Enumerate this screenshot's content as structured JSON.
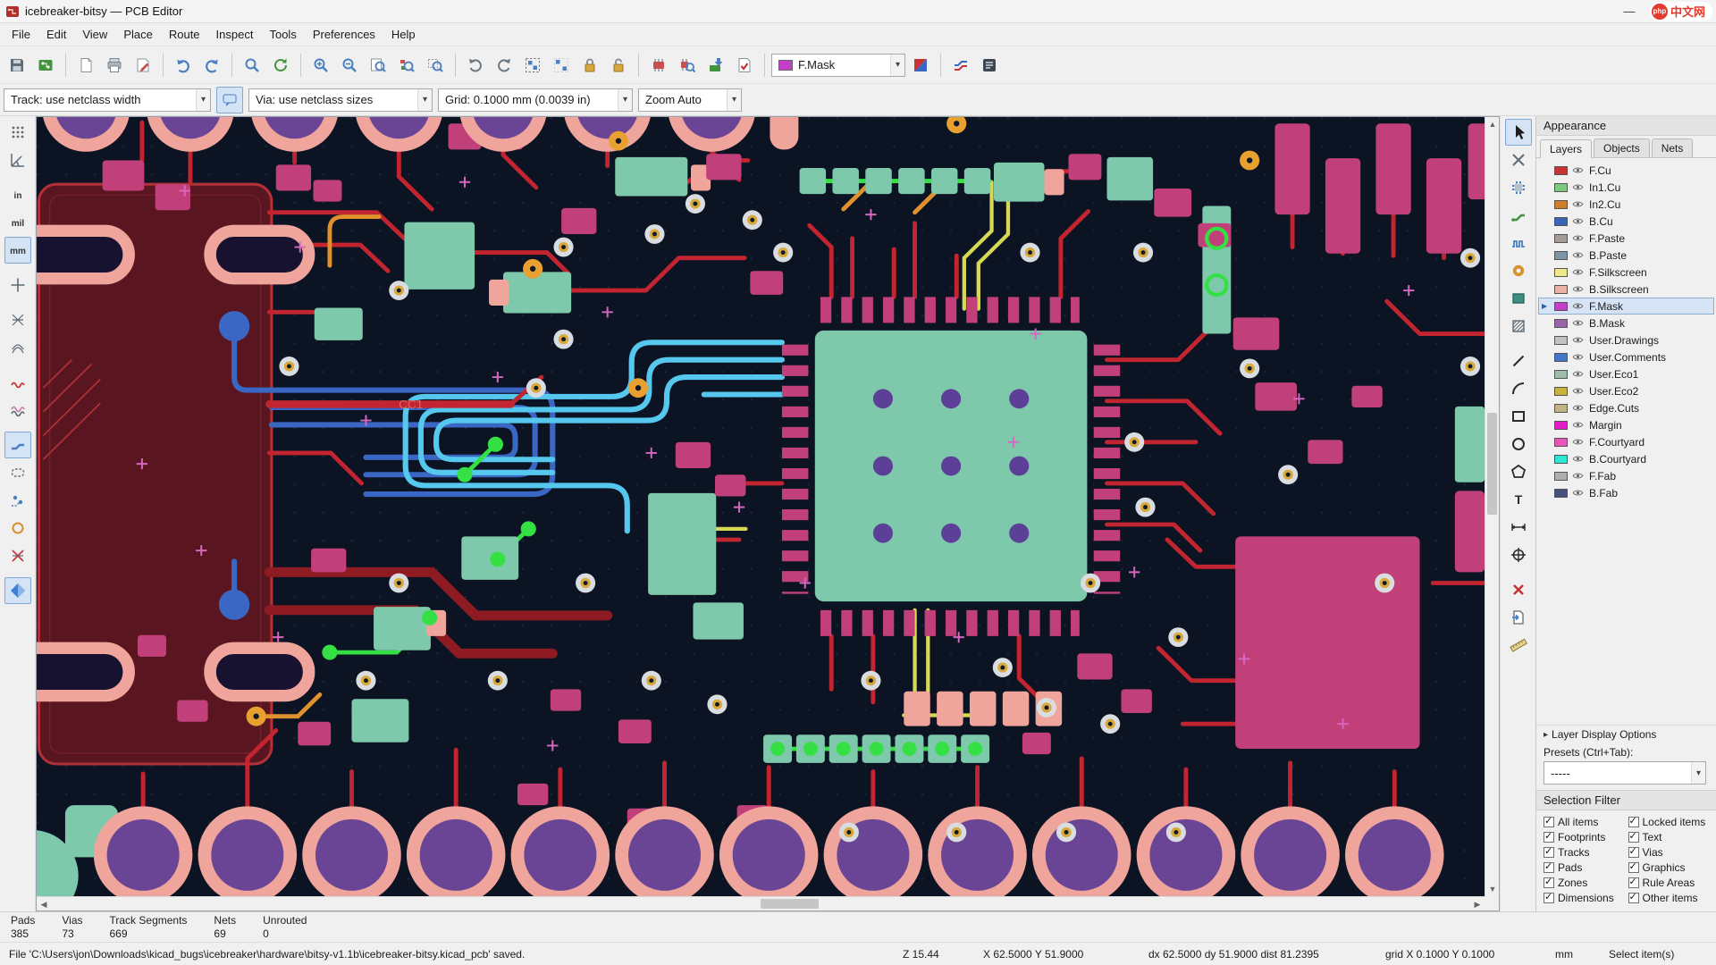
{
  "window": {
    "title": "icebreaker-bitsy — PCB Editor",
    "minimize_glyph": "—",
    "brand_logo": "php",
    "brand_text": "中文网"
  },
  "menubar": {
    "items": [
      "File",
      "Edit",
      "View",
      "Place",
      "Route",
      "Inspect",
      "Tools",
      "Preferences",
      "Help"
    ]
  },
  "toolbar": {
    "layer_combo": "F.Mask",
    "layer_color": "#C33FC7",
    "track_combo": "Track: use netclass width",
    "via_combo": "Via: use netclass sizes",
    "grid_combo": "Grid: 0.1000 mm (0.0039 in)",
    "zoom_combo": "Zoom Auto"
  },
  "left_toolbar": {
    "units": [
      "in",
      "mil",
      "mm"
    ]
  },
  "canvas": {
    "net_label": "CC1"
  },
  "appearance": {
    "title": "Appearance",
    "tabs": [
      {
        "label": "Layers",
        "active": true
      },
      {
        "label": "Objects",
        "active": false
      },
      {
        "label": "Nets",
        "active": false
      }
    ],
    "layers": [
      {
        "name": "F.Cu",
        "color": "#C83434",
        "selected": false
      },
      {
        "name": "In1.Cu",
        "color": "#7FC87F",
        "selected": false
      },
      {
        "name": "In2.Cu",
        "color": "#CE7D2C",
        "selected": false
      },
      {
        "name": "B.Cu",
        "color": "#3C64B4",
        "selected": false
      },
      {
        "name": "F.Paste",
        "color": "#A49A96",
        "selected": false
      },
      {
        "name": "B.Paste",
        "color": "#7E95A6",
        "selected": false
      },
      {
        "name": "F.Silkscreen",
        "color": "#EFE88A",
        "selected": false
      },
      {
        "name": "B.Silkscreen",
        "color": "#E8B2A6",
        "selected": false
      },
      {
        "name": "F.Mask",
        "color": "#C33FC7",
        "selected": true
      },
      {
        "name": "B.Mask",
        "color": "#9A62A8",
        "selected": false
      },
      {
        "name": "User.Drawings",
        "color": "#C2C2C2",
        "selected": false
      },
      {
        "name": "User.Comments",
        "color": "#4177C4",
        "selected": false
      },
      {
        "name": "User.Eco1",
        "color": "#9EBCAA",
        "selected": false
      },
      {
        "name": "User.Eco2",
        "color": "#C8B33C",
        "selected": false
      },
      {
        "name": "Edge.Cuts",
        "color": "#C2B382",
        "selected": false
      },
      {
        "name": "Margin",
        "color": "#E21EC8",
        "selected": false
      },
      {
        "name": "F.Courtyard",
        "color": "#E857B8",
        "selected": false
      },
      {
        "name": "B.Courtyard",
        "color": "#2EE6D6",
        "selected": false
      },
      {
        "name": "F.Fab",
        "color": "#AFAFAF",
        "selected": false
      },
      {
        "name": "B.Fab",
        "color": "#46507E",
        "selected": false
      }
    ],
    "layer_display_options": "Layer Display Options",
    "presets_label": "Presets (Ctrl+Tab):",
    "presets_value": "-----"
  },
  "selection_filter": {
    "title": "Selection Filter",
    "items": [
      {
        "label": "All items",
        "checked": true
      },
      {
        "label": "Locked items",
        "checked": true
      },
      {
        "label": "Footprints",
        "checked": true
      },
      {
        "label": "Text",
        "checked": true
      },
      {
        "label": "Tracks",
        "checked": true
      },
      {
        "label": "Vias",
        "checked": true
      },
      {
        "label": "Pads",
        "checked": true
      },
      {
        "label": "Graphics",
        "checked": true
      },
      {
        "label": "Zones",
        "checked": true
      },
      {
        "label": "Rule Areas",
        "checked": true
      },
      {
        "label": "Dimensions",
        "checked": true
      },
      {
        "label": "Other items",
        "checked": true
      }
    ]
  },
  "statusbar": {
    "stats": [
      {
        "label": "Pads",
        "value": "385"
      },
      {
        "label": "Vias",
        "value": "73"
      },
      {
        "label": "Track Segments",
        "value": "669"
      },
      {
        "label": "Nets",
        "value": "69"
      },
      {
        "label": "Unrouted",
        "value": "0"
      }
    ],
    "message": "File 'C:\\Users\\jon\\Downloads\\kicad_bugs\\icebreaker\\hardware\\bitsy-v1.1b\\icebreaker-bitsy.kicad_pcb' saved.",
    "zoom": "Z 15.44",
    "cursor": "X 62.5000  Y 51.9000",
    "delta": "dx 62.5000  dy 51.9000  dist 81.2395",
    "grid": "grid X 0.1000  Y 0.1000",
    "units": "mm",
    "hint": "Select item(s)"
  }
}
